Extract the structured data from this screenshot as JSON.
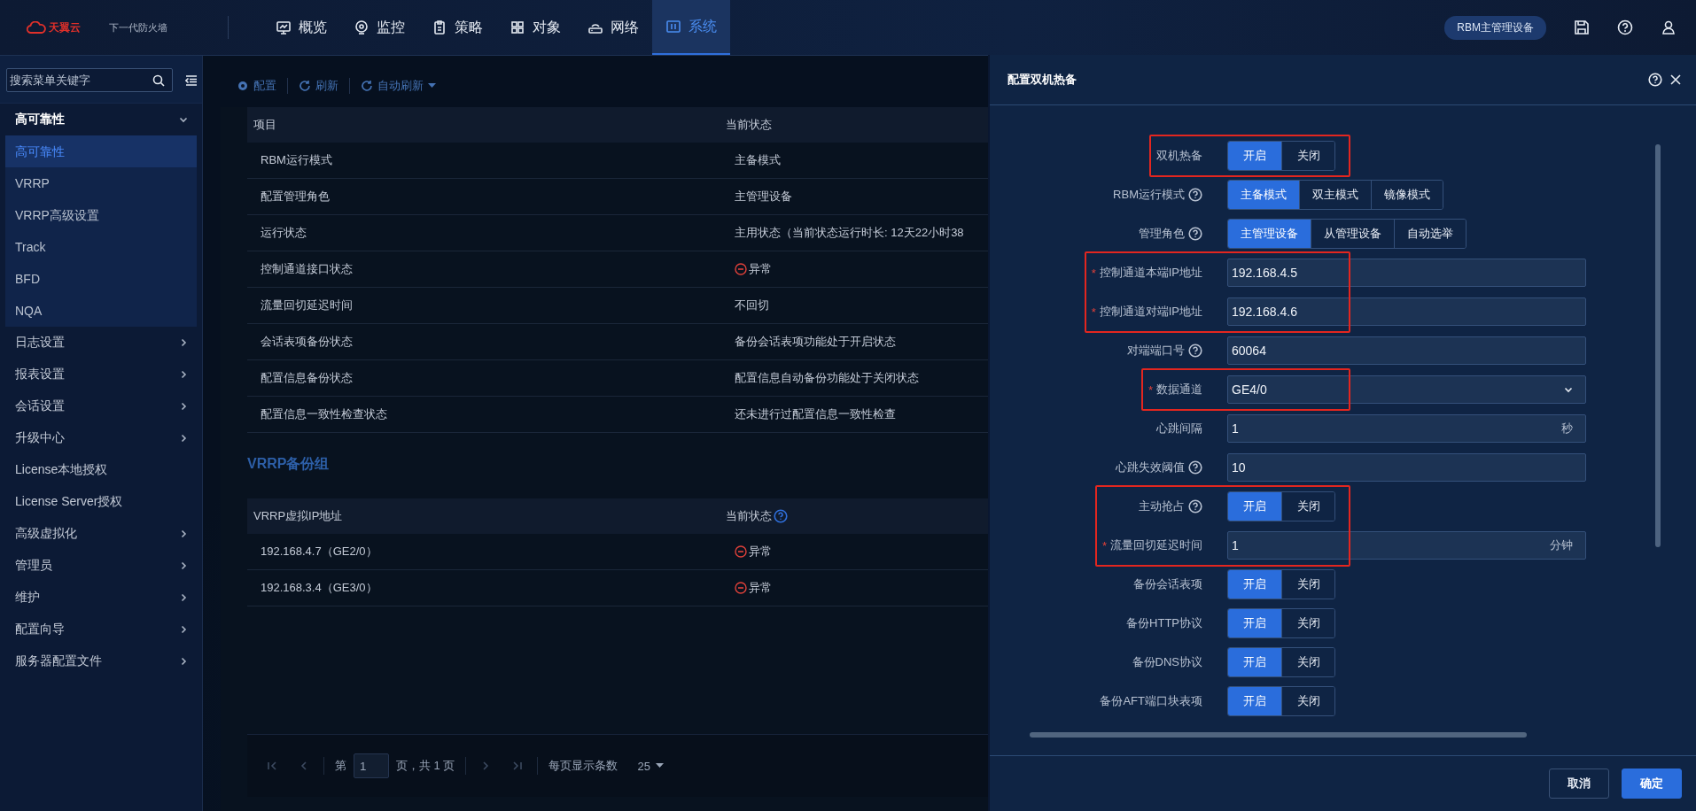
{
  "header": {
    "brand": "天翼云",
    "product": "下一代防火墙",
    "nav": [
      {
        "label": "概览",
        "selected": false
      },
      {
        "label": "监控",
        "selected": false
      },
      {
        "label": "策略",
        "selected": false
      },
      {
        "label": "对象",
        "selected": false
      },
      {
        "label": "网络",
        "selected": false
      },
      {
        "label": "系统",
        "selected": true
      }
    ],
    "device_badge": "RBM主管理设备"
  },
  "sidebar": {
    "search_placeholder": "搜索菜单关键字",
    "items": [
      {
        "label": "高可靠性",
        "expanded": true,
        "children": [
          {
            "label": "高可靠性",
            "selected": true
          },
          {
            "label": "VRRP",
            "selected": false
          },
          {
            "label": "VRRP高级设置",
            "selected": false
          },
          {
            "label": "Track",
            "selected": false
          },
          {
            "label": "BFD",
            "selected": false
          },
          {
            "label": "NQA",
            "selected": false
          }
        ]
      },
      {
        "label": "日志设置",
        "expanded": false
      },
      {
        "label": "报表设置",
        "expanded": false
      },
      {
        "label": "会话设置",
        "expanded": false
      },
      {
        "label": "升级中心",
        "expanded": false
      },
      {
        "label": "License本地授权"
      },
      {
        "label": "License Server授权"
      },
      {
        "label": "高级虚拟化",
        "expanded": false
      },
      {
        "label": "管理员",
        "expanded": false
      },
      {
        "label": "维护",
        "expanded": false
      },
      {
        "label": "配置向导",
        "expanded": false
      },
      {
        "label": "服务器配置文件",
        "expanded": false
      }
    ]
  },
  "toolbar": [
    {
      "kind": "config",
      "label": "配置"
    },
    {
      "kind": "refresh",
      "label": "刷新"
    },
    {
      "kind": "auto",
      "label": "自动刷新"
    }
  ],
  "status_table": {
    "columns": [
      {
        "label": "项目"
      },
      {
        "label": "当前状态"
      }
    ],
    "rows": [
      {
        "item": "RBM运行模式",
        "status": "主备模式",
        "error": false
      },
      {
        "item": "配置管理角色",
        "status": "主管理设备",
        "error": false
      },
      {
        "item": "运行状态",
        "status": "主用状态（当前状态运行时长: 12天22小时38",
        "error": false
      },
      {
        "item": "控制通道接口状态",
        "status": "异常",
        "error": true
      },
      {
        "item": "流量回切延迟时间",
        "status": "不回切",
        "error": false
      },
      {
        "item": "会话表项备份状态",
        "status": "备份会话表项功能处于开启状态",
        "error": false
      },
      {
        "item": "配置信息备份状态",
        "status": "配置信息自动备份功能处于关闭状态",
        "error": false
      },
      {
        "item": "配置信息一致性检查状态",
        "status": "还未进行过配置信息一致性检查",
        "error": false
      }
    ]
  },
  "vrrp": {
    "title": "VRRP备份组",
    "columns": [
      {
        "label": "VRRP虚拟IP地址",
        "help": false
      },
      {
        "label": "当前状态",
        "help": true
      }
    ],
    "rows": [
      {
        "item": "192.168.4.7（GE2/0）",
        "status": "异常",
        "error": true
      },
      {
        "item": "192.168.3.4（GE3/0）",
        "status": "异常",
        "error": true
      }
    ]
  },
  "pagination": {
    "page_prefix": "第",
    "page": "1",
    "page_suffix": "页，共 1 页",
    "page_size_label": "每页显示条数",
    "page_size": "25"
  },
  "drawer": {
    "title": "配置双机热备",
    "groups": [
      {
        "highlighted": true,
        "rows": [
          {
            "kind": "toggle",
            "label": "双机热备",
            "options": [
              {
                "label": "开启",
                "selected": true
              },
              {
                "label": "关闭",
                "selected": false
              }
            ]
          }
        ]
      },
      {
        "highlighted": false,
        "rows": [
          {
            "kind": "toggle",
            "label": "RBM运行模式",
            "help": true,
            "options": [
              {
                "label": "主备模式",
                "selected": true
              },
              {
                "label": "双主模式",
                "selected": false
              },
              {
                "label": "镜像模式",
                "selected": false
              }
            ]
          },
          {
            "kind": "toggle",
            "label": "管理角色",
            "help": true,
            "options": [
              {
                "label": "主管理设备",
                "selected": true
              },
              {
                "label": "从管理设备",
                "selected": false
              },
              {
                "label": "自动选举",
                "selected": false
              }
            ]
          }
        ]
      },
      {
        "highlighted": true,
        "rows": [
          {
            "kind": "input",
            "required_mark": "*",
            "label": "控制通道本端IP地址",
            "value": "192.168.4.5"
          },
          {
            "kind": "input",
            "required_mark": "*",
            "label": "控制通道对端IP地址",
            "value": "192.168.4.6"
          }
        ]
      },
      {
        "highlighted": false,
        "rows": [
          {
            "kind": "input",
            "label": "对端端口号",
            "help": true,
            "value": "60064"
          }
        ]
      },
      {
        "highlighted": true,
        "rows": [
          {
            "kind": "select",
            "required_mark": "*",
            "label": "数据通道",
            "value": "GE4/0"
          }
        ]
      },
      {
        "highlighted": false,
        "rows": [
          {
            "kind": "input",
            "label": "心跳间隔",
            "value": "1",
            "unit": "秒"
          },
          {
            "kind": "input",
            "label": "心跳失效阈值",
            "help": true,
            "value": "10"
          }
        ]
      },
      {
        "highlighted": true,
        "rows": [
          {
            "kind": "toggle",
            "label": "主动抢占",
            "help": true,
            "options": [
              {
                "label": "开启",
                "selected": true
              },
              {
                "label": "关闭",
                "selected": false
              }
            ]
          },
          {
            "kind": "input",
            "required_mark": "*",
            "label": "流量回切延迟时间",
            "value": "1",
            "unit": "分钟"
          }
        ]
      },
      {
        "highlighted": false,
        "rows": [
          {
            "kind": "toggle",
            "label": "备份会话表项",
            "options": [
              {
                "label": "开启",
                "selected": true
              },
              {
                "label": "关闭",
                "selected": false
              }
            ]
          },
          {
            "kind": "toggle",
            "label": "备份HTTP协议",
            "options": [
              {
                "label": "开启",
                "selected": true
              },
              {
                "label": "关闭",
                "selected": false
              }
            ]
          },
          {
            "kind": "toggle",
            "label": "备份DNS协议",
            "options": [
              {
                "label": "开启",
                "selected": true
              },
              {
                "label": "关闭",
                "selected": false
              }
            ]
          },
          {
            "kind": "toggle",
            "label": "备份AFT端口块表项",
            "options": [
              {
                "label": "开启",
                "selected": true
              },
              {
                "label": "关闭",
                "selected": false
              }
            ]
          }
        ]
      }
    ],
    "buttons": [
      {
        "label": "取消",
        "primary": false
      },
      {
        "label": "确定",
        "primary": true
      }
    ]
  }
}
